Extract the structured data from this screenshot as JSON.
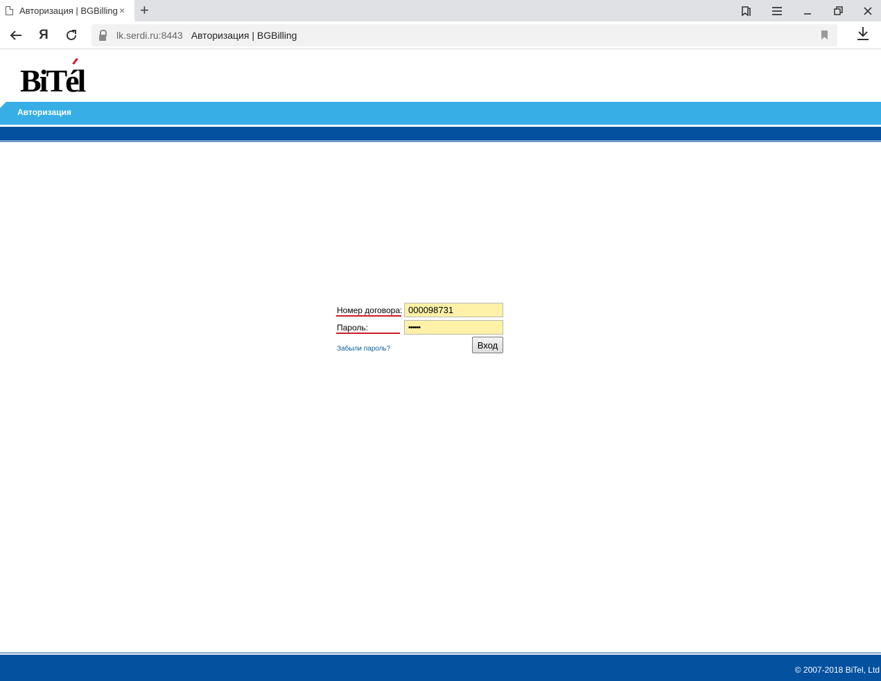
{
  "browser": {
    "tab_title": "Авторизация | BGBilling",
    "tab_close": "×",
    "new_tab": "+",
    "yandex_button": "Я",
    "url_host": "lk.serdi.ru:8443",
    "url_page_title": "Авторизация | BGBilling"
  },
  "header": {
    "logo_text": "BiTél",
    "menu_item": "Авторизация"
  },
  "login": {
    "contract_label": "Номер договора:",
    "contract_value": "000098731",
    "password_label": "Пароль:",
    "password_value": "••••••",
    "submit_label": "Вход",
    "forgot_link": "Забыли пароль?"
  },
  "footer": {
    "copyright": "© 2007-2018 BiTel, Ltd"
  },
  "colors": {
    "menu_bar": "#37aee6",
    "dark_bar": "#0451a0",
    "input_bg": "#fff1a8",
    "underline": "#cc1a28",
    "link": "#0b5d9c"
  }
}
